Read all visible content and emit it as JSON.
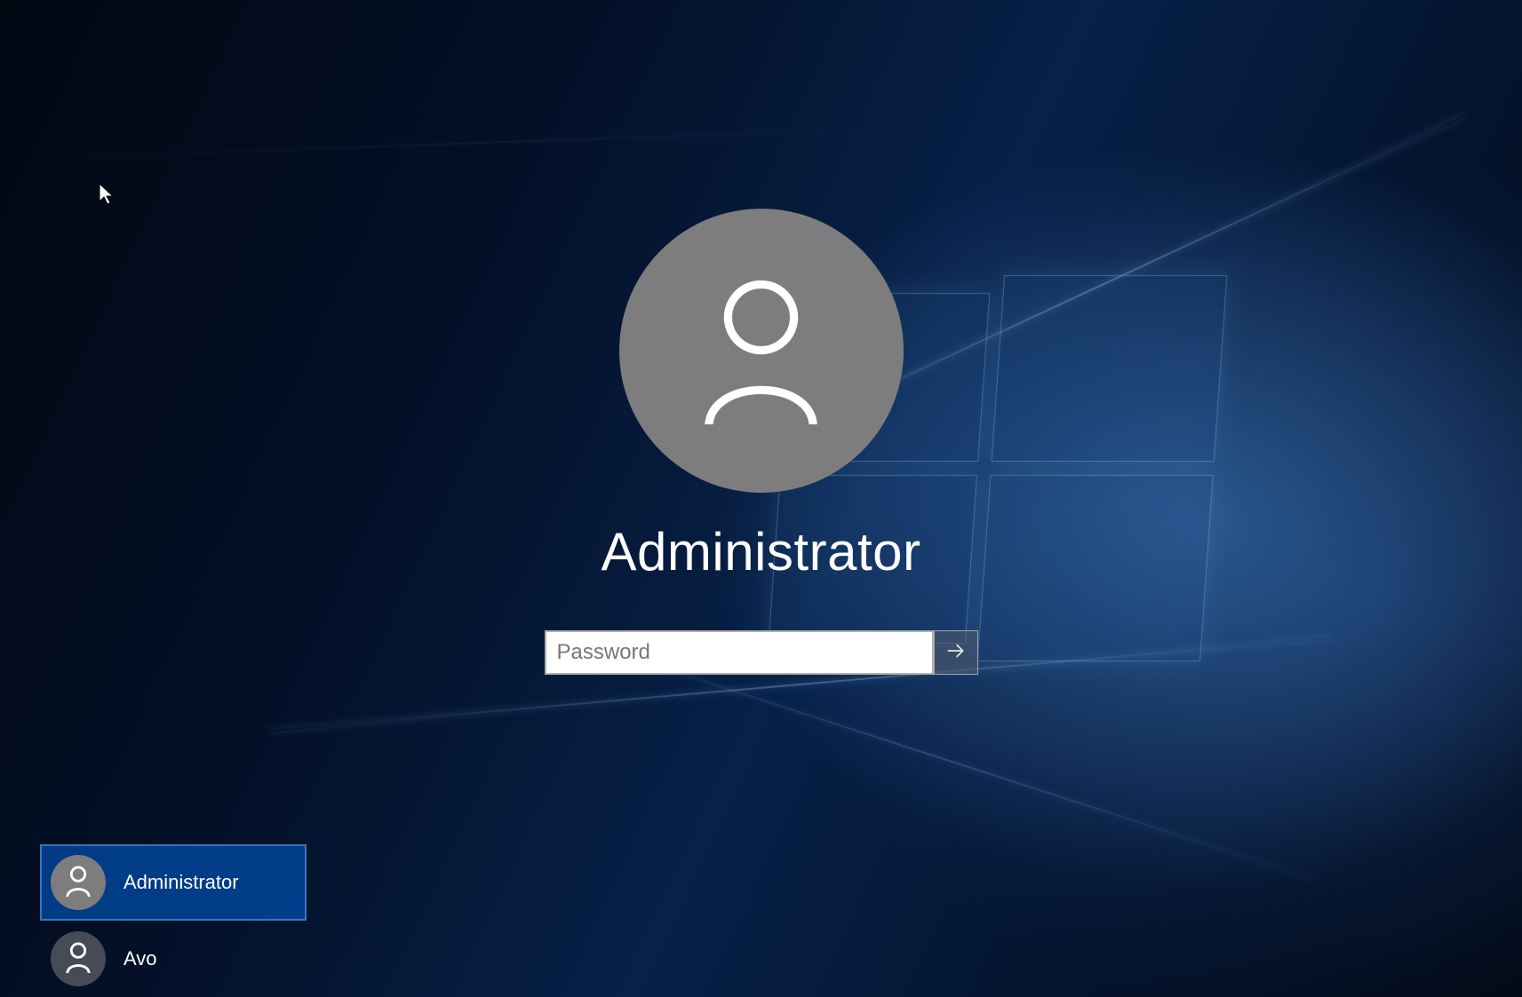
{
  "login": {
    "selected_user": "Administrator",
    "password_placeholder": "Password",
    "password_value": ""
  },
  "icons": {
    "submit": "arrow-right-icon",
    "avatar": "user-icon"
  },
  "users": [
    {
      "name": "Administrator",
      "selected": true
    },
    {
      "name": "Avo",
      "selected": false
    }
  ],
  "colors": {
    "accent": "#0063B1",
    "avatar_bg": "#7d7d7d"
  }
}
